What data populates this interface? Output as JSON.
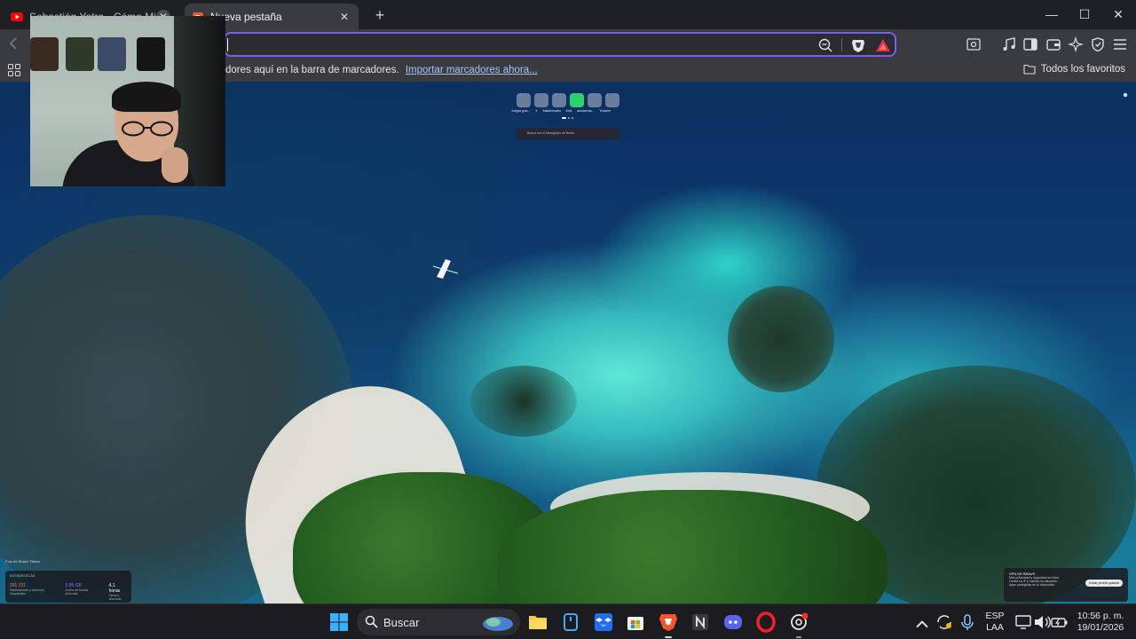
{
  "tabs": [
    {
      "title": "Sebastián Yatra - Cómo Mirarte",
      "active": false,
      "favicon": "youtube-icon"
    },
    {
      "title": "Nueva pestaña",
      "active": true,
      "favicon": "brave-lion-icon"
    }
  ],
  "new_tab_symbol": "+",
  "tab_close_symbol": "✕",
  "window_controls": {
    "minimize": "—",
    "maximize": "☐",
    "close": "✕"
  },
  "toolbar": {
    "address_value": "",
    "icons": [
      "zoom-icon",
      "brave-shields-icon",
      "brave-rewards-icon",
      "media-icon",
      "sidebar-icon",
      "wallet-icon",
      "leo-ai-icon",
      "vpn-icon",
      "menu-icon"
    ]
  },
  "bookmarks_bar": {
    "prompt": "dores aquí en la barra de marcadores.",
    "import_link": "Importar marcadores ahora...",
    "all_bookmarks": "Todos los favoritos"
  },
  "new_tab_page": {
    "speed_dial_labels": [
      "Juegos grat...",
      "X",
      "Matamesaba",
      "Kick",
      "almasenta...",
      "Youtube"
    ],
    "search_placeholder": "Busca con el Navegador de Brave",
    "stats": {
      "title": "ESTADÍSTICAS",
      "items": [
        {
          "value": "291.721",
          "label": "Rastreadores y anuncios bloqueados"
        },
        {
          "value": "5,85 GB",
          "label": "Ancho de banda ahorrado"
        },
        {
          "value": "4,1 horas",
          "label": "Tiempo ahorrado"
        }
      ]
    },
    "photo_credit": "Foto de Shane Tilston",
    "vpn_card": {
      "title": "VPN DE BRAVE",
      "lines": [
        "Más privacidad y seguridad en línea",
        "Oculta su IP y cambia su ubicación",
        "Apps protegidas en tu dispositivo"
      ],
      "button": "Iniciar prueba gratuita"
    }
  },
  "taskbar": {
    "search_label": "Buscar",
    "language": [
      "ESP",
      "LAA"
    ],
    "time": "10:56 p. m.",
    "date": "19/01/2026"
  },
  "colors": {
    "accent": "#7c5cf0",
    "tab_active": "#3a3b3f",
    "link": "#a9c2ff"
  }
}
